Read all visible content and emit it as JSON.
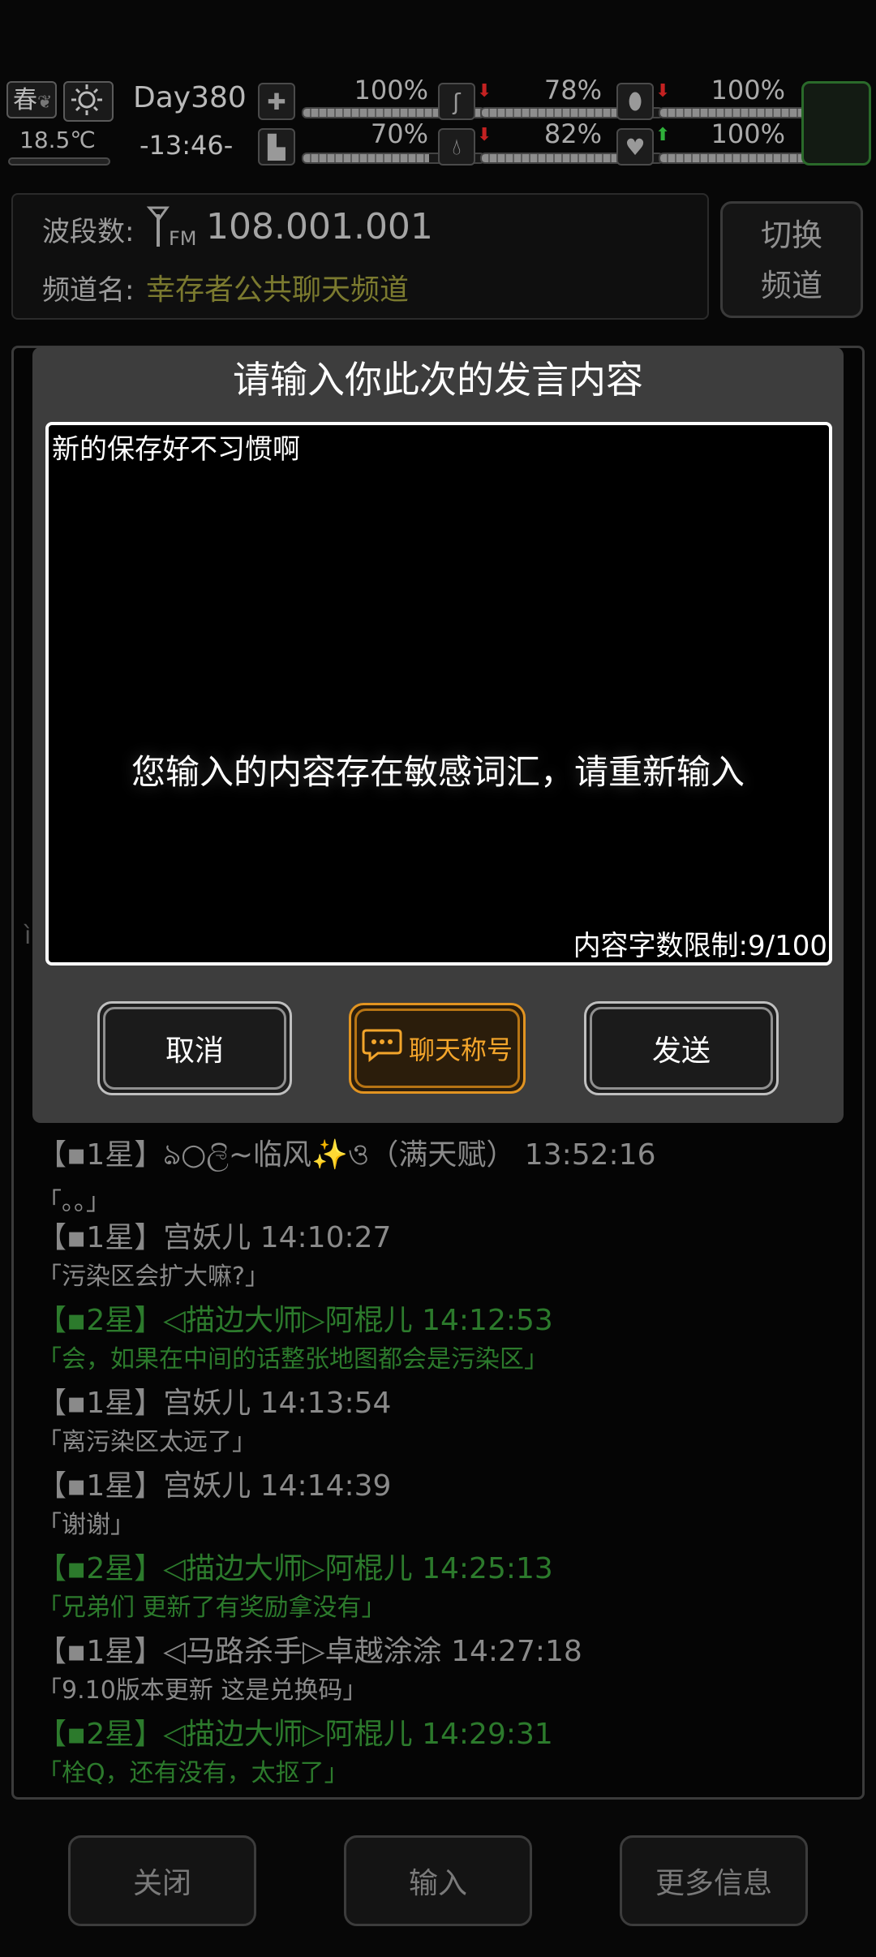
{
  "status": {
    "season": "春",
    "temperature": "18.5℃",
    "day": "Day380",
    "time": "-13:46-",
    "stats": [
      {
        "name": "health",
        "value": "100%",
        "level": 1.0
      },
      {
        "name": "hunger",
        "value": "78%",
        "level": 0.78
      },
      {
        "name": "mood",
        "value": "100%",
        "level": 1.0
      },
      {
        "name": "stamina",
        "value": "70%",
        "level": 0.7
      },
      {
        "name": "thirst",
        "value": "82%",
        "level": 0.82
      },
      {
        "name": "life",
        "value": "100%",
        "level": 1.0
      }
    ]
  },
  "radio": {
    "band_label": "波段数:",
    "frequency": "108.001.001",
    "channel_label": "频道名:",
    "channel_name": "幸存者公共聊天频道",
    "switch_line1": "切换",
    "switch_line2": "频道"
  },
  "dialog": {
    "title": "请输入你此次的发言内容",
    "input_value": "新的保存好不习惯啊",
    "char_limit": "内容字数限制:9/100",
    "toast": "您输入的内容存在敏感词汇，请重新输入",
    "cancel": "取消",
    "chat_title": "聊天称号",
    "send": "发送"
  },
  "messages": [
    {
      "head": "【▪1星】ঌ○ලි~临风✨ও（满天赋） 13:52:16",
      "body": "「。。」",
      "green": false
    },
    {
      "head": "【▪1星】宫妖儿 14:10:27",
      "body": "「污染区会扩大嘛?」",
      "green": false
    },
    {
      "head": "【▪2星】◁描边大师▷阿棍儿 14:12:53",
      "body": "「会，如果在中间的话整张地图都会是污染区」",
      "green": true
    },
    {
      "head": "【▪1星】宫妖儿 14:13:54",
      "body": "「离污染区太远了」",
      "green": false
    },
    {
      "head": "【▪1星】宫妖儿 14:14:39",
      "body": "「谢谢」",
      "green": false
    },
    {
      "head": "【▪2星】◁描边大师▷阿棍儿 14:25:13",
      "body": "「兄弟们 更新了有奖励拿没有」",
      "green": true
    },
    {
      "head": "【▪1星】◁马路杀手▷卓越涂涂 14:27:18",
      "body": "「9.10版本更新  这是兑换码」",
      "green": false
    },
    {
      "head": "【▪2星】◁描边大师▷阿棍儿 14:29:31",
      "body": "「栓Q，还有没有，太抠了」",
      "green": true
    }
  ],
  "bottom": {
    "close": "关闭",
    "input": "输入",
    "more": "更多信息"
  },
  "colors": {
    "accent_orange": "#e29421",
    "chat_green": "#2c7a2c",
    "channel_yellow": "#7b7a2f"
  }
}
